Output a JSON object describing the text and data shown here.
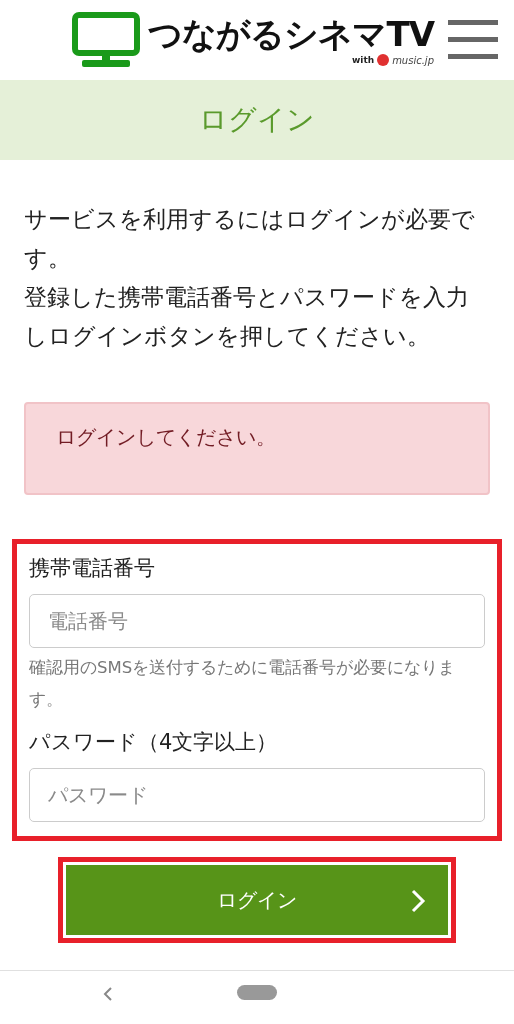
{
  "header": {
    "logo_title": "つながるシネマTV",
    "logo_with": "with",
    "logo_sub": "music.jp"
  },
  "page_title": "ログイン",
  "intro": [
    "サービスを利用するにはログインが必要です。",
    "登録した携帯電話番号とパスワードを入力しログインボタンを押してください。"
  ],
  "alert": "ログインしてください。",
  "form": {
    "fields": [
      {
        "label": "携帯電話番号",
        "placeholder": "電話番号",
        "help": "確認用のSMSを送付するために電話番号が必要になります。"
      },
      {
        "label": "パスワード（4文字以上）",
        "placeholder": "パスワード"
      }
    ],
    "highlighted": true
  },
  "login_button": {
    "label": "ログイン",
    "highlighted": true
  }
}
